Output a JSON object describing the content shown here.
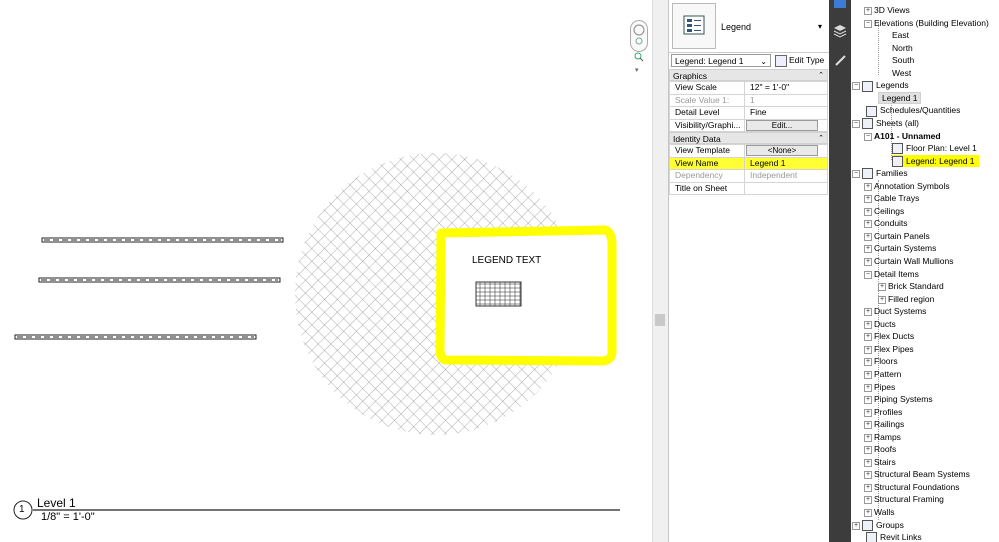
{
  "canvas": {
    "legend_text": "LEGEND TEXT",
    "view_number": "1",
    "view_title": "Level 1",
    "view_scale": "1/8\" = 1'-0\""
  },
  "properties": {
    "type_name": "Legend",
    "instance_selector": "Legend: Legend 1",
    "edit_type_label": "Edit Type",
    "groups": {
      "graphics": "Graphics",
      "identity": "Identity Data"
    },
    "graphics_rows": [
      {
        "key": "View Scale",
        "value": "12\" = 1'-0\""
      },
      {
        "key": "Scale Value    1:",
        "value": "1"
      },
      {
        "key": "Detail Level",
        "value": "Fine"
      },
      {
        "key": "Visibility/Graphi...",
        "value": "Edit..."
      }
    ],
    "identity_rows": [
      {
        "key": "View Template",
        "value": "<None>"
      },
      {
        "key": "View Name",
        "value": "Legend 1"
      },
      {
        "key": "Dependency",
        "value": "Independent"
      },
      {
        "key": "Title on Sheet",
        "value": ""
      }
    ]
  },
  "browser": {
    "items": [
      {
        "label": "3D Views",
        "depth": 1,
        "toggle": "+",
        "icon": false
      },
      {
        "label": "Elevations (Building Elevation)",
        "depth": 1,
        "toggle": "-",
        "icon": false
      },
      {
        "label": "East",
        "depth": 2,
        "toggle": "",
        "icon": false
      },
      {
        "label": "North",
        "depth": 2,
        "toggle": "",
        "icon": false
      },
      {
        "label": "South",
        "depth": 2,
        "toggle": "",
        "icon": false
      },
      {
        "label": "West",
        "depth": 2,
        "toggle": "",
        "icon": false
      },
      {
        "label": "Legends",
        "depth": 0,
        "toggle": "-",
        "icon": true
      },
      {
        "label": "Legend 1",
        "depth": 1,
        "toggle": "",
        "icon": false,
        "selected": true
      },
      {
        "label": "Schedules/Quantities",
        "depth": 0,
        "toggle": "",
        "icon": true
      },
      {
        "label": "Sheets (all)",
        "depth": 0,
        "toggle": "-",
        "icon": true
      },
      {
        "label": "A101 - Unnamed",
        "depth": 1,
        "toggle": "-",
        "icon": false,
        "bold": true
      },
      {
        "label": "Floor Plan: Level 1",
        "depth": 2,
        "toggle": "",
        "icon": true
      },
      {
        "label": "Legend: Legend 1",
        "depth": 2,
        "toggle": "",
        "icon": true,
        "highlight": true
      },
      {
        "label": "Families",
        "depth": 0,
        "toggle": "-",
        "icon": true
      },
      {
        "label": "Annotation Symbols",
        "depth": 1,
        "toggle": "+",
        "icon": false
      },
      {
        "label": "Cable Trays",
        "depth": 1,
        "toggle": "+",
        "icon": false
      },
      {
        "label": "Ceilings",
        "depth": 1,
        "toggle": "+",
        "icon": false
      },
      {
        "label": "Conduits",
        "depth": 1,
        "toggle": "+",
        "icon": false
      },
      {
        "label": "Curtain Panels",
        "depth": 1,
        "toggle": "+",
        "icon": false
      },
      {
        "label": "Curtain Systems",
        "depth": 1,
        "toggle": "+",
        "icon": false
      },
      {
        "label": "Curtain Wall Mullions",
        "depth": 1,
        "toggle": "+",
        "icon": false
      },
      {
        "label": "Detail Items",
        "depth": 1,
        "toggle": "-",
        "icon": false
      },
      {
        "label": "Brick Standard",
        "depth": 2,
        "toggle": "+",
        "icon": false
      },
      {
        "label": "Filled region",
        "depth": 2,
        "toggle": "+",
        "icon": false
      },
      {
        "label": "Duct Systems",
        "depth": 1,
        "toggle": "+",
        "icon": false
      },
      {
        "label": "Ducts",
        "depth": 1,
        "toggle": "+",
        "icon": false
      },
      {
        "label": "Flex Ducts",
        "depth": 1,
        "toggle": "+",
        "icon": false
      },
      {
        "label": "Flex Pipes",
        "depth": 1,
        "toggle": "+",
        "icon": false
      },
      {
        "label": "Floors",
        "depth": 1,
        "toggle": "+",
        "icon": false
      },
      {
        "label": "Pattern",
        "depth": 1,
        "toggle": "+",
        "icon": false
      },
      {
        "label": "Pipes",
        "depth": 1,
        "toggle": "+",
        "icon": false
      },
      {
        "label": "Piping Systems",
        "depth": 1,
        "toggle": "+",
        "icon": false
      },
      {
        "label": "Profiles",
        "depth": 1,
        "toggle": "+",
        "icon": false
      },
      {
        "label": "Railings",
        "depth": 1,
        "toggle": "+",
        "icon": false
      },
      {
        "label": "Ramps",
        "depth": 1,
        "toggle": "+",
        "icon": false
      },
      {
        "label": "Roofs",
        "depth": 1,
        "toggle": "+",
        "icon": false
      },
      {
        "label": "Stairs",
        "depth": 1,
        "toggle": "+",
        "icon": false
      },
      {
        "label": "Structural Beam Systems",
        "depth": 1,
        "toggle": "+",
        "icon": false
      },
      {
        "label": "Structural Foundations",
        "depth": 1,
        "toggle": "+",
        "icon": false
      },
      {
        "label": "Structural Framing",
        "depth": 1,
        "toggle": "+",
        "icon": false
      },
      {
        "label": "Walls",
        "depth": 1,
        "toggle": "+",
        "icon": false
      },
      {
        "label": "Groups",
        "depth": 0,
        "toggle": "+",
        "icon": true
      },
      {
        "label": "Revit Links",
        "depth": 0,
        "toggle": "",
        "icon": true
      }
    ]
  },
  "colors": {
    "highlight": "#ffff00",
    "dark_strip": "#3c3c3c",
    "group_header": "#e6e6e6"
  }
}
